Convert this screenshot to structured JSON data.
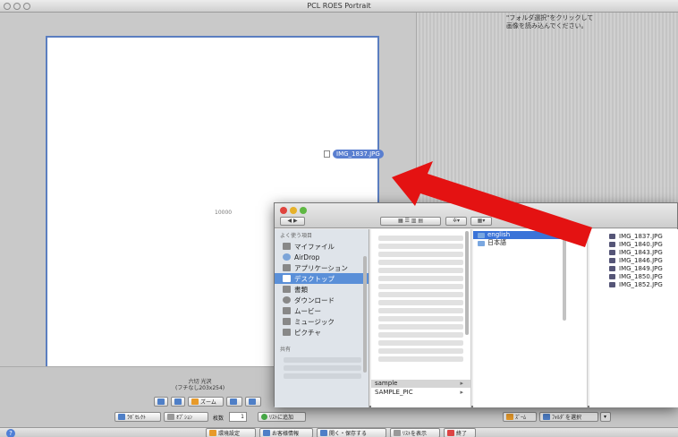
{
  "window": {
    "title": "PCL ROES Portrait"
  },
  "canvas": {
    "page_number": "10000",
    "dragged_file": "IMG_1837.JPG"
  },
  "right_panel": {
    "instruction_line1": "\"フォルダ選択\"をクリックして",
    "instruction_line2": "画像を読み込んでください。"
  },
  "paper": {
    "size_line1": "六切 光沢",
    "size_line2": "(フチなし203x254)"
  },
  "toolbar": {
    "zoom": "ズーム",
    "lab_select": "ﾗﾎﾞｾﾚｸﾄ",
    "options": "ｵﾌﾟｼｮﾝ",
    "copies_label": "枚数",
    "copies_value": "1",
    "add_to_list": "ﾘｽﾄに追加",
    "zoom_right": "ｽﾞｰﾑ",
    "folder_select": "ﾌｫﾙﾀﾞを選択"
  },
  "footer": {
    "help": "?",
    "settings": "環境設定",
    "customer_info": "お客様情報",
    "open_save": "開く・保存する",
    "show_list": "ﾘｽﾄを表示",
    "quit": "終了"
  },
  "finder": {
    "sidebar_header": "よく使う項目",
    "sidebar_items": [
      "マイファイル",
      "AirDrop",
      "アプリケーション",
      "デスクトップ",
      "書類",
      "ダウンロード",
      "ムービー",
      "ミュージック",
      "ピクチャ"
    ],
    "shared_header": "共有",
    "col2_items": [
      "sample",
      "SAMPLE_PIC"
    ],
    "col3_items": [
      "english",
      "日本語"
    ],
    "files": [
      "IMG_1837.JPG",
      "IMG_1840.JPG",
      "IMG_1843.JPG",
      "IMG_1846.JPG",
      "IMG_1849.JPG",
      "IMG_1850.JPG",
      "IMG_1852.JPG"
    ]
  },
  "colors": {
    "accent": "#3a73d8",
    "arrow": "#e41212",
    "page_border": "#5b7ec0"
  }
}
